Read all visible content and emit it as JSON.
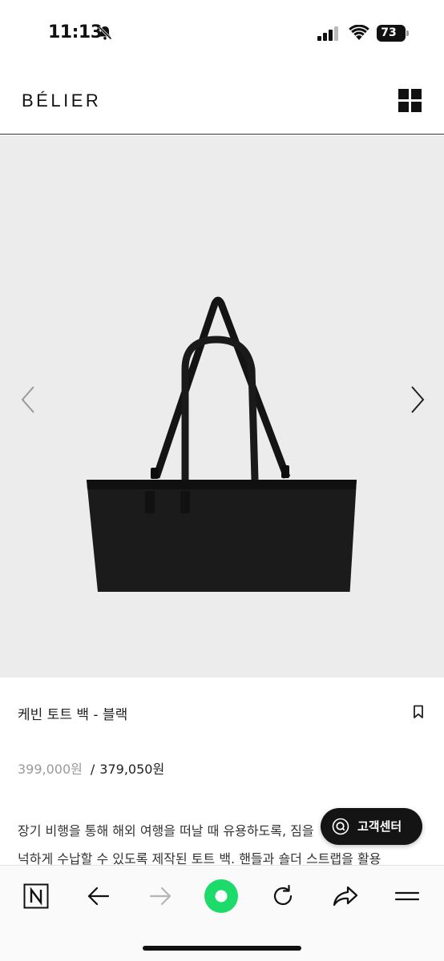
{
  "status_bar": {
    "time": "11:13",
    "battery": "73",
    "icons": [
      "bell-slash-icon",
      "signal-icon",
      "wifi-icon",
      "battery-icon"
    ]
  },
  "header": {
    "brand": "BÉLIER",
    "menu_icon": "grid-menu-icon"
  },
  "gallery": {
    "prev_icon": "chevron-left-icon",
    "next_icon": "chevron-right-icon",
    "image": "black-tote-bag"
  },
  "product": {
    "title": "케빈 토트 백 - 블랙",
    "price_original": "399,000원",
    "price_separator": "/",
    "price_sale": "379,050원",
    "description_line1": "장기 비행을 통해 해외 여행을 떠날 때 유용하도록, 짐을",
    "description_line2": "넉하게 수납할 수 있도록 제작된 토트 백. 핸들과 숄더 스트랩을 활용"
  },
  "customer_service": {
    "label": "고객센터",
    "icon": "chat-q-icon"
  },
  "toolbar": {
    "items": [
      "naver-n-icon",
      "back-arrow-icon",
      "forward-arrow-icon",
      "green-home-icon",
      "refresh-icon",
      "share-icon",
      "menu-lines-icon"
    ]
  },
  "colors": {
    "accent_green": "#1ddb6a",
    "gallery_bg": "#ececec",
    "dark": "#141414"
  }
}
